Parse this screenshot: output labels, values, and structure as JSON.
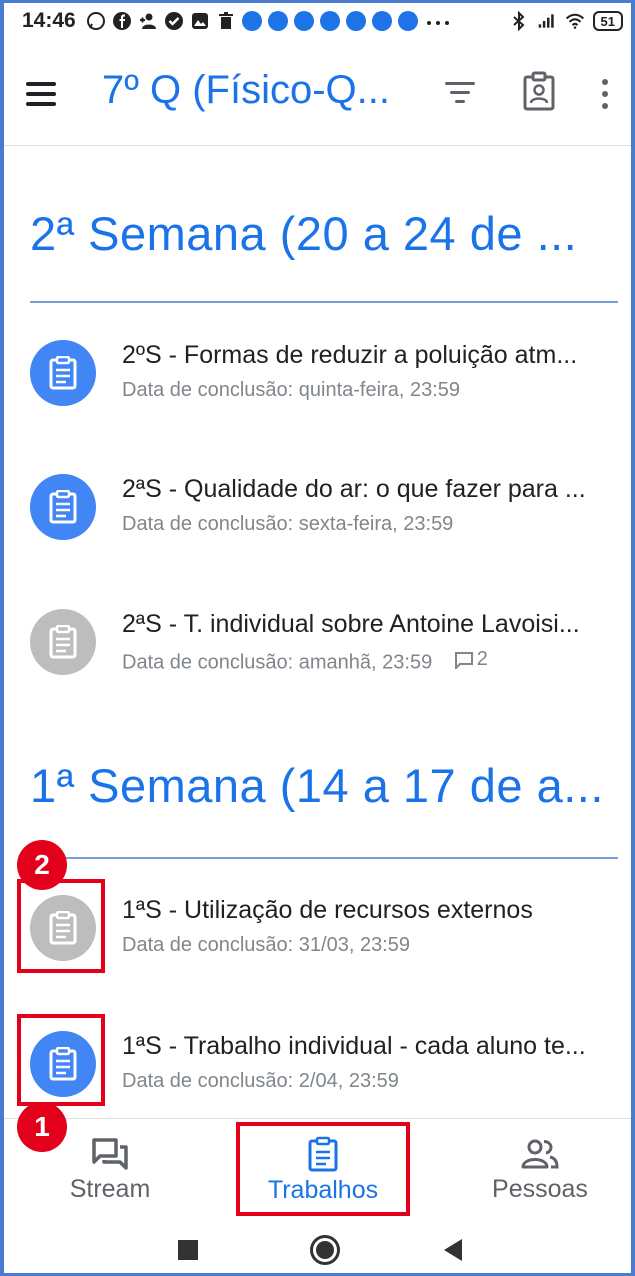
{
  "status_bar": {
    "time": "14:46",
    "battery": "51"
  },
  "app_bar": {
    "title": "7º Q (Físico-Q..."
  },
  "sections": [
    {
      "title": "2ª Semana (20 a 24 de ...",
      "items": [
        {
          "title": "2ºS - Formas de reduzir a poluição atm...",
          "due": "Data de conclusão: quinta-feira, 23:59",
          "icon_color": "blue"
        },
        {
          "title": "2ªS - Qualidade do ar: o que fazer para ...",
          "due": "Data de conclusão: sexta-feira, 23:59",
          "icon_color": "grey"
        },
        {
          "title": "2ªS - T. individual sobre Antoine Lavoisi...",
          "due": "Data de conclusão: amanhã, 23:59",
          "comments": "2",
          "icon_color": "grey"
        }
      ]
    },
    {
      "title": "1ª Semana (14 a 17 de a...",
      "items": [
        {
          "title": "1ªS -  Utilização de recursos externos",
          "due": "Data de conclusão: 31/03, 23:59",
          "icon_color": "grey"
        },
        {
          "title": "1ªS - Trabalho individual - cada aluno te...",
          "due": "Data de conclusão: 2/04, 23:59",
          "icon_color": "blue"
        }
      ]
    }
  ],
  "annotations": {
    "badge_1": "1",
    "badge_2": "2",
    "color": "#e3001b"
  },
  "bottom_nav": {
    "tabs": [
      {
        "label": "Stream",
        "icon": "stream-icon"
      },
      {
        "label": "Trabalhos",
        "icon": "classwork-icon",
        "active": true
      },
      {
        "label": "Pessoas",
        "icon": "people-icon"
      }
    ]
  },
  "colors": {
    "accent": "#1a73e8",
    "assignment_blue": "#4285f4",
    "assignment_grey": "#bdbdbd"
  }
}
